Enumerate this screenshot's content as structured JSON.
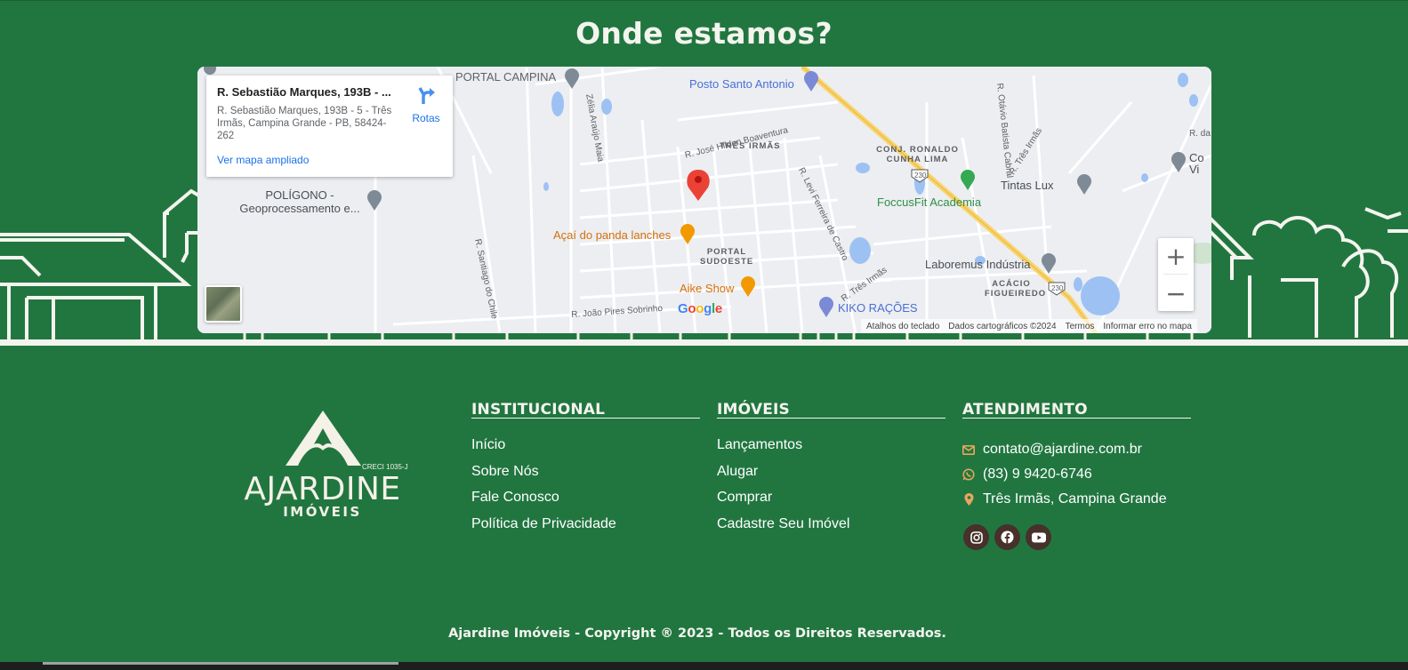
{
  "section": {
    "title": "Onde estamos?"
  },
  "map": {
    "info_card": {
      "title": "R. Sebastião Marques, 193B - ...",
      "address": "R. Sebastião Marques, 193B - 5 - Três Irmãs, Campina Grande - PB, 58424-262",
      "directions_label": "Rotas",
      "larger_map_link": "Ver mapa ampliado"
    },
    "labels": {
      "portal_campina": "PORTAL CAMPINA",
      "posto": "Posto Santo Antonio",
      "tres_irmas_area": "TRÊS IRMÃS",
      "conj_ronaldo": "CONJ. RONALDO CUNHA LIMA",
      "tintas_lux": "Tintas Lux",
      "foccusfit": "FoccusFit Academia",
      "poligono": "POLÍGONO - Geoprocessamento e...",
      "acai": "Açaí do panda lanches",
      "portal_sudoeste": "PORTAL SUDOESTE",
      "laboremus": "Laboremus Indústria",
      "acacio": "ACÁCIO FIGUEIREDO",
      "aike": "Aike Show",
      "kiko": "KIKO RAÇÕES",
      "road_zelia": "Zélia Araújo Maia",
      "road_hildon": "R. José Hildon Boaventura",
      "road_otavio": "R. Otávio Batista Cabral",
      "road_tres_irmas": "R. Três Irmãs",
      "road_levi": "R. Levi Ferreira de Castro",
      "road_santiago": "R. Santiago do Chile",
      "road_joao": "R. João Pires Sobrinho",
      "road_tres_irmas2": "R. Três Irmãs",
      "shield_230": "230",
      "corner_da": "R. da",
      "corner_co": "Co",
      "corner_vi": "Vi"
    },
    "attribution": {
      "keyboard": "Atalhos do teclado",
      "data": "Dados cartográficos ©2024",
      "terms": "Termos",
      "report": "Informar erro no mapa"
    },
    "google": "Google"
  },
  "footer": {
    "logo": {
      "name": "AJARDINE",
      "sub": "IMÓVEIS",
      "creci": "CRECI 1035-J"
    },
    "institucional": {
      "title": "INSTITUCIONAL",
      "items": [
        "Início",
        "Sobre Nós",
        "Fale Conosco",
        "Política de Privacidade"
      ]
    },
    "imoveis": {
      "title": "IMÓVEIS",
      "items": [
        "Lançamentos",
        "Alugar",
        "Comprar",
        "Cadastre Seu Imóvel"
      ]
    },
    "atendimento": {
      "title": "ATENDIMENTO",
      "email": "contato@ajardine.com.br",
      "phone": "(83) 9 9420-6746",
      "location": "Três Irmãs, Campina Grande"
    },
    "socials": [
      "instagram-icon",
      "facebook-icon",
      "youtube-icon"
    ],
    "copyright": "Ajardine Imóveis - Copyright ® 2023 - Todos os Direitos Reservados."
  },
  "colors": {
    "background": "#217640",
    "accent": "#e8a65d",
    "social_bg": "#47312a",
    "link": "#1a73e8"
  }
}
